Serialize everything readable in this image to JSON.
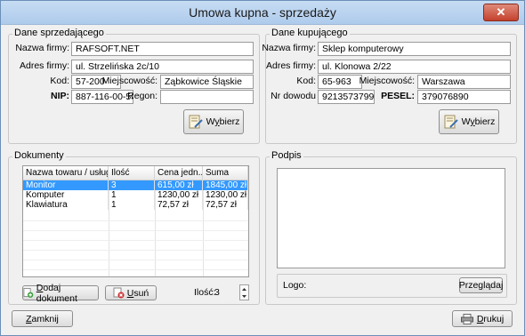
{
  "window": {
    "title": "Umowa kupna - sprzedaży",
    "close": "✕"
  },
  "seller": {
    "legend": "Dane sprzedającego",
    "company_label": "Nazwa firmy:",
    "company": "RAFSOFT.NET",
    "address_label": "Adres firmy:",
    "address": "ul. Strzelińska 2c/10",
    "postcode_label": "Kod:",
    "postcode": "57-200",
    "city_label": "Miejscowość:",
    "city": "Ząbkowice Śląskie",
    "nip_label": "NIP:",
    "nip": "887-116-00-53",
    "regon_label": "Regon:",
    "regon": "",
    "choose_pre": "W",
    "choose_u": "y",
    "choose_post": "bierz"
  },
  "buyer": {
    "legend": "Dane kupującego",
    "company_label": "Nazwa firmy:",
    "company": "Sklep komputerowy",
    "address_label": "Adres firmy:",
    "address": "ul. Klonowa 2/22",
    "postcode_label": "Kod:",
    "postcode": "65-963",
    "city_label": "Miejscowość:",
    "city": "Warszawa",
    "id_label": "Nr dowodu",
    "id_number": "9213573799",
    "pesel_label": "PESEL:",
    "pesel": "379076890",
    "choose_pre": "W",
    "choose_u": "y",
    "choose_post": "bierz"
  },
  "documents": {
    "legend": "Dokumenty",
    "columns": [
      "Nazwa towaru / usługi",
      "Ilość",
      "Cena jedn...",
      "Suma"
    ],
    "rows": [
      [
        "Monitor",
        "3",
        "615,00 zł",
        "1845,00 zł"
      ],
      [
        "Komputer",
        "1",
        "1230,00 zł",
        "1230,00 zł"
      ],
      [
        "Klawiatura",
        "1",
        "72,57 zł",
        "72,57 zł"
      ]
    ],
    "add_pre": "",
    "add_u": "D",
    "add_post": "odaj dokument",
    "remove_pre": "",
    "remove_u": "U",
    "remove_post": "suń",
    "qty_label": "Ilość:",
    "qty_value": "3"
  },
  "signature": {
    "legend": "Podpis",
    "logo_label": "Logo:",
    "browse_pre": "Prze",
    "browse_u": "g",
    "browse_post": "lądaj"
  },
  "footer": {
    "close_pre": "",
    "close_u": "Z",
    "close_post": "amknij",
    "print_pre": "",
    "print_u": "D",
    "print_post": "rukuj"
  },
  "colors": {
    "selection": "#3399ff",
    "title_bar": "#aecbec",
    "close_button": "#c4412d"
  }
}
